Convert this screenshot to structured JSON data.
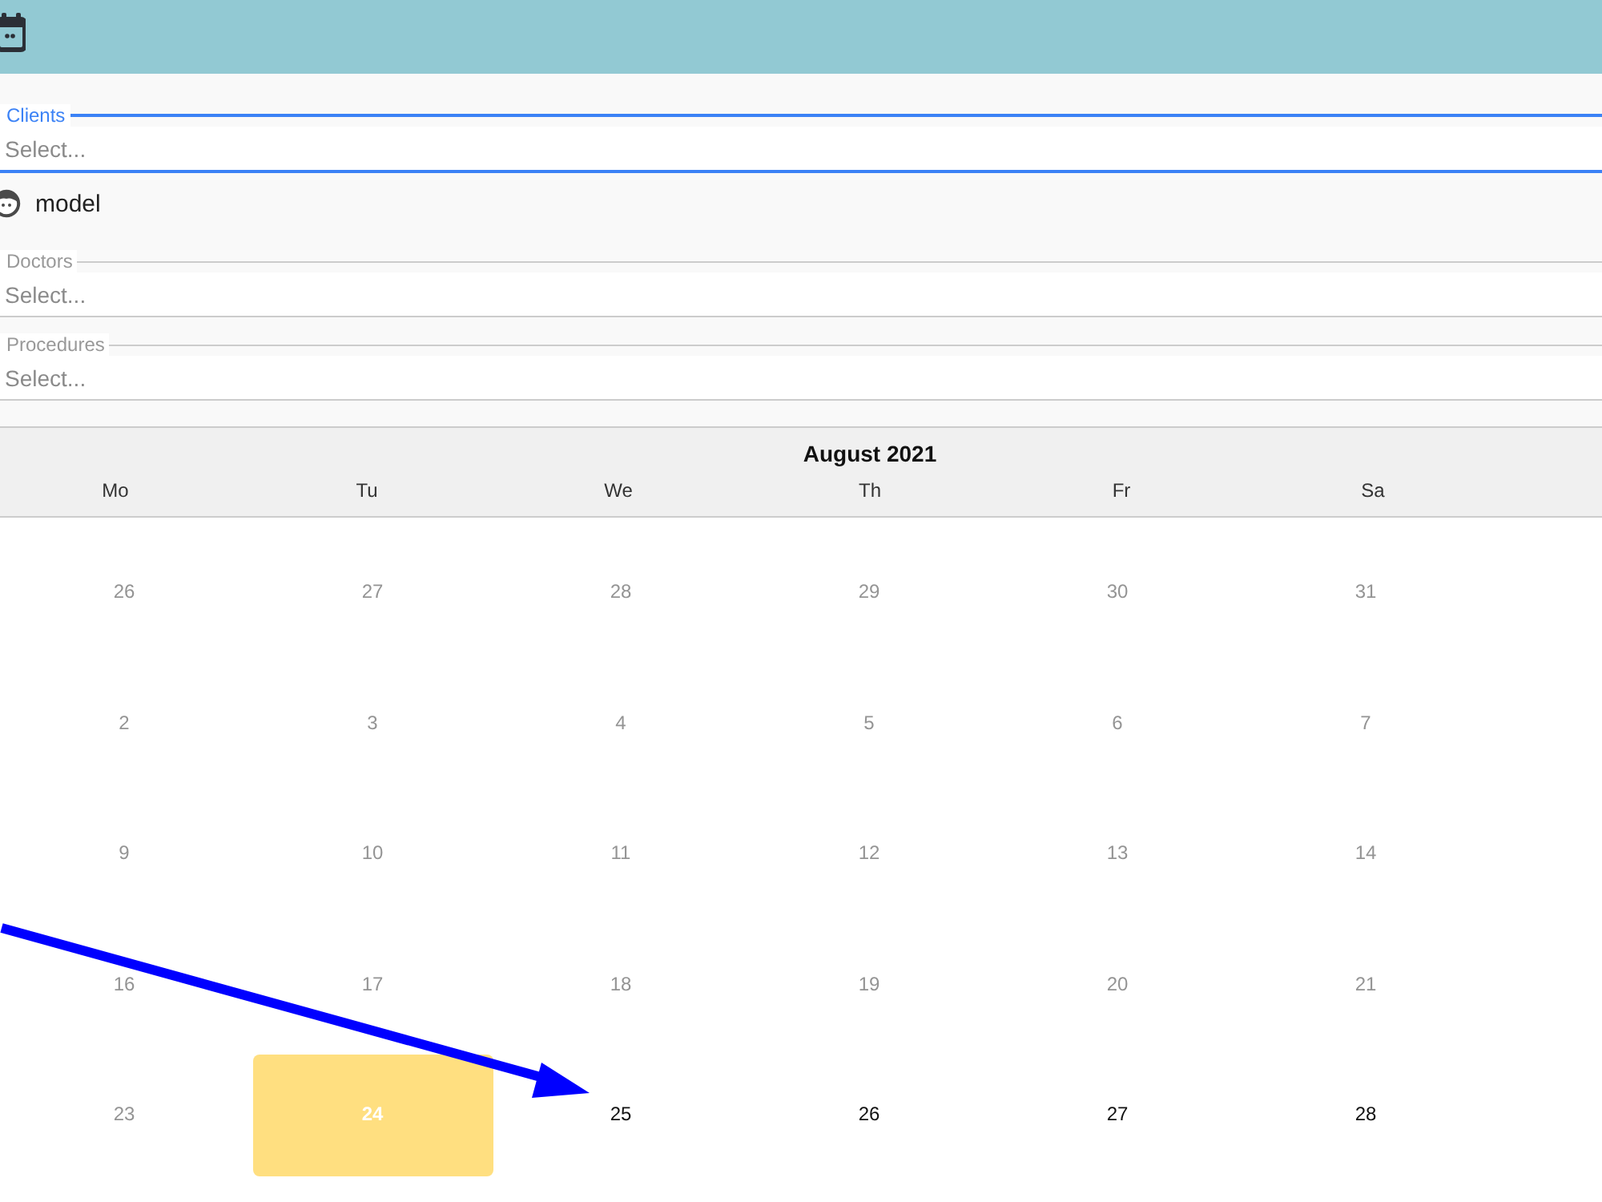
{
  "fields": [
    {
      "label": "Clients",
      "placeholder": "Select...",
      "focused": true,
      "selected_items": [
        {
          "name": "model"
        }
      ]
    },
    {
      "label": "Doctors",
      "placeholder": "Select...",
      "focused": false
    },
    {
      "label": "Procedures",
      "placeholder": "Select...",
      "focused": false
    }
  ],
  "calendar": {
    "title": "August 2021",
    "weekdays": [
      "Mo",
      "Tu",
      "We",
      "Th",
      "Fr",
      "Sa"
    ],
    "weeks": [
      [
        {
          "day": "26",
          "disabled": true,
          "selected": false
        },
        {
          "day": "27",
          "disabled": true,
          "selected": false
        },
        {
          "day": "28",
          "disabled": true,
          "selected": false
        },
        {
          "day": "29",
          "disabled": true,
          "selected": false
        },
        {
          "day": "30",
          "disabled": true,
          "selected": false
        },
        {
          "day": "31",
          "disabled": true,
          "selected": false
        }
      ],
      [
        {
          "day": "2",
          "disabled": true,
          "selected": false
        },
        {
          "day": "3",
          "disabled": true,
          "selected": false
        },
        {
          "day": "4",
          "disabled": true,
          "selected": false
        },
        {
          "day": "5",
          "disabled": true,
          "selected": false
        },
        {
          "day": "6",
          "disabled": true,
          "selected": false
        },
        {
          "day": "7",
          "disabled": true,
          "selected": false
        }
      ],
      [
        {
          "day": "9",
          "disabled": true,
          "selected": false
        },
        {
          "day": "10",
          "disabled": true,
          "selected": false
        },
        {
          "day": "11",
          "disabled": true,
          "selected": false
        },
        {
          "day": "12",
          "disabled": true,
          "selected": false
        },
        {
          "day": "13",
          "disabled": true,
          "selected": false
        },
        {
          "day": "14",
          "disabled": true,
          "selected": false
        }
      ],
      [
        {
          "day": "16",
          "disabled": true,
          "selected": false
        },
        {
          "day": "17",
          "disabled": true,
          "selected": false
        },
        {
          "day": "18",
          "disabled": true,
          "selected": false
        },
        {
          "day": "19",
          "disabled": true,
          "selected": false
        },
        {
          "day": "20",
          "disabled": true,
          "selected": false
        },
        {
          "day": "21",
          "disabled": true,
          "selected": false
        }
      ],
      [
        {
          "day": "23",
          "disabled": true,
          "selected": false
        },
        {
          "day": "24",
          "disabled": false,
          "selected": true
        },
        {
          "day": "25",
          "disabled": false,
          "selected": false
        },
        {
          "day": "26",
          "disabled": false,
          "selected": false
        },
        {
          "day": "27",
          "disabled": false,
          "selected": false
        },
        {
          "day": "28",
          "disabled": false,
          "selected": false
        }
      ]
    ]
  }
}
